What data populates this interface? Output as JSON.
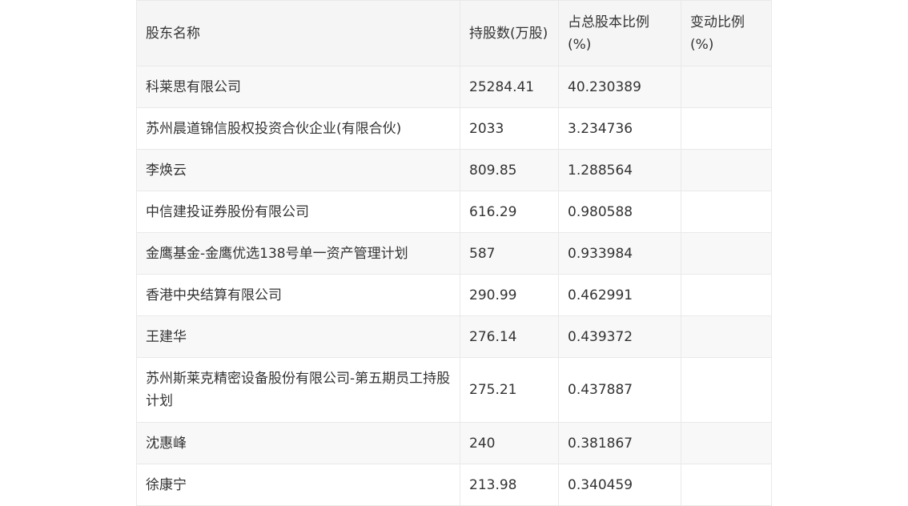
{
  "table": {
    "headers": [
      "股东名称",
      "持股数(万股)",
      "占总股本比例(%)",
      "变动比例(%)"
    ],
    "rows": [
      [
        "科莱思有限公司",
        "25284.41",
        "40.230389",
        ""
      ],
      [
        "苏州晨道锦信股权投资合伙企业(有限合伙)",
        "2033",
        "3.234736",
        ""
      ],
      [
        "李焕云",
        "809.85",
        "1.288564",
        ""
      ],
      [
        "中信建投证券股份有限公司",
        "616.29",
        "0.980588",
        ""
      ],
      [
        "金鹰基金-金鹰优选138号单一资产管理计划",
        "587",
        "0.933984",
        ""
      ],
      [
        "香港中央结算有限公司",
        "290.99",
        "0.462991",
        ""
      ],
      [
        "王建华",
        "276.14",
        "0.439372",
        ""
      ],
      [
        "苏州斯莱克精密设备股份有限公司-第五期员工持股计划",
        "275.21",
        "0.437887",
        ""
      ],
      [
        "沈惠峰",
        "240",
        "0.381867",
        ""
      ],
      [
        "徐康宁",
        "213.98",
        "0.340459",
        ""
      ]
    ]
  }
}
